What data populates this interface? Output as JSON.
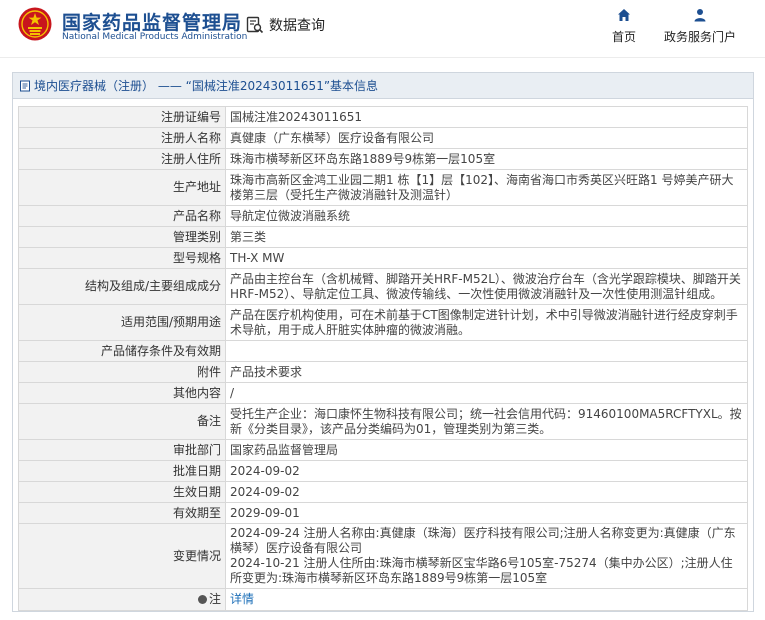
{
  "brand": {
    "name_cn": "国家药品监督管理局",
    "name_en": "National Medical Products Administration"
  },
  "nav": {
    "search_label": "数据查询",
    "home_label": "首页",
    "portal_label": "政务服务门户"
  },
  "colors": {
    "brand_blue": "#1d4f91",
    "link_blue": "#1d6fb8",
    "emblem_red": "#c8161d"
  },
  "panel": {
    "title": "境内医疗器械（注册） —— “国械注准20243011651”基本信息"
  },
  "rows": [
    {
      "label": "注册证编号",
      "value": "国械注准20243011651"
    },
    {
      "label": "注册人名称",
      "value": "真健康（广东横琴）医疗设备有限公司"
    },
    {
      "label": "注册人住所",
      "value": "珠海市横琴新区环岛东路1889号9栋第一层105室"
    },
    {
      "label": "生产地址",
      "value": "珠海市高新区金鸿工业园二期1 栋【1】层【102】、海南省海口市秀英区兴旺路1 号婷美产研大楼第三层（受托生产微波消融针及测温针）"
    },
    {
      "label": "产品名称",
      "value": "导航定位微波消融系统"
    },
    {
      "label": "管理类别",
      "value": "第三类"
    },
    {
      "label": "型号规格",
      "value": "TH-X MW"
    },
    {
      "label": "结构及组成/主要组成成分",
      "value": "产品由主控台车（含机械臂、脚踏开关HRF-M52L）、微波治疗台车（含光学跟踪模块、脚踏开关HRF-M52）、导航定位工具、微波传输线、一次性使用微波消融针及一次性使用测温针组成。"
    },
    {
      "label": "适用范围/预期用途",
      "value": "产品在医疗机构使用，可在术前基于CT图像制定进针计划，术中引导微波消融针进行经皮穿刺手术导航，用于成人肝脏实体肿瘤的微波消融。"
    },
    {
      "label": "产品储存条件及有效期",
      "value": ""
    },
    {
      "label": "附件",
      "value": "产品技术要求"
    },
    {
      "label": "其他内容",
      "value": "/"
    },
    {
      "label": "备注",
      "value": "受托生产企业：海口康怀生物科技有限公司；统一社会信用代码：91460100MA5RCFTYXL。按新《分类目录》，该产品分类编码为01，管理类别为第三类。"
    },
    {
      "label": "审批部门",
      "value": "国家药品监督管理局"
    },
    {
      "label": "批准日期",
      "value": "2024-09-02"
    },
    {
      "label": "生效日期",
      "value": "2024-09-02"
    },
    {
      "label": "有效期至",
      "value": "2029-09-01"
    },
    {
      "label": "变更情况",
      "value": "2024-09-24 注册人名称由:真健康（珠海）医疗科技有限公司;注册人名称变更为:真健康（广东横琴）医疗设备有限公司\n2024-10-21 注册人住所由:珠海市横琴新区宝华路6号105室-75274（集中办公区）;注册人住所变更为:珠海市横琴新区环岛东路1889号9栋第一层105室"
    }
  ],
  "note": {
    "label": "注",
    "link_text": "详情"
  }
}
